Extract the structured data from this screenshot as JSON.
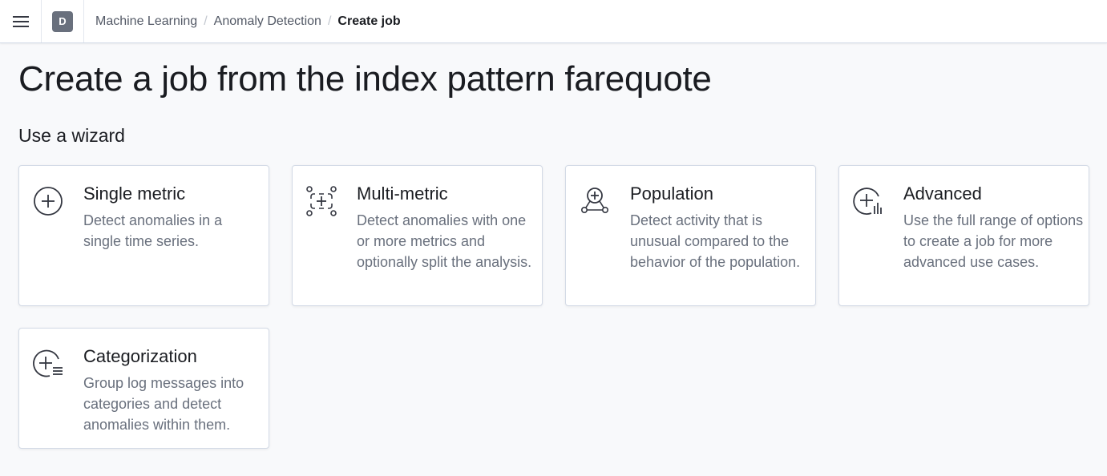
{
  "header": {
    "menu_icon": "hamburger-menu-icon",
    "space_avatar": "D",
    "breadcrumbs": [
      "Machine Learning",
      "Anomaly Detection",
      "Create job"
    ],
    "breadcrumb_separator": "/"
  },
  "page": {
    "title": "Create a job from the index pattern farequote",
    "section_title": "Use a wizard"
  },
  "wizards": [
    {
      "icon": "plus-in-circle-icon",
      "title": "Single metric",
      "description": "Detect anomalies in a single time series."
    },
    {
      "icon": "multi-metric-icon",
      "title": "Multi-metric",
      "description": "Detect anomalies with one or more metrics and optionally split the analysis."
    },
    {
      "icon": "population-icon",
      "title": "Population",
      "description": "Detect activity that is unusual compared to the behavior of the population."
    },
    {
      "icon": "advanced-icon",
      "title": "Advanced",
      "description": "Use the full range of options to create a job for more advanced use cases."
    },
    {
      "icon": "categorization-icon",
      "title": "Categorization",
      "description": "Group log messages into categories and detect anomalies within them."
    }
  ]
}
